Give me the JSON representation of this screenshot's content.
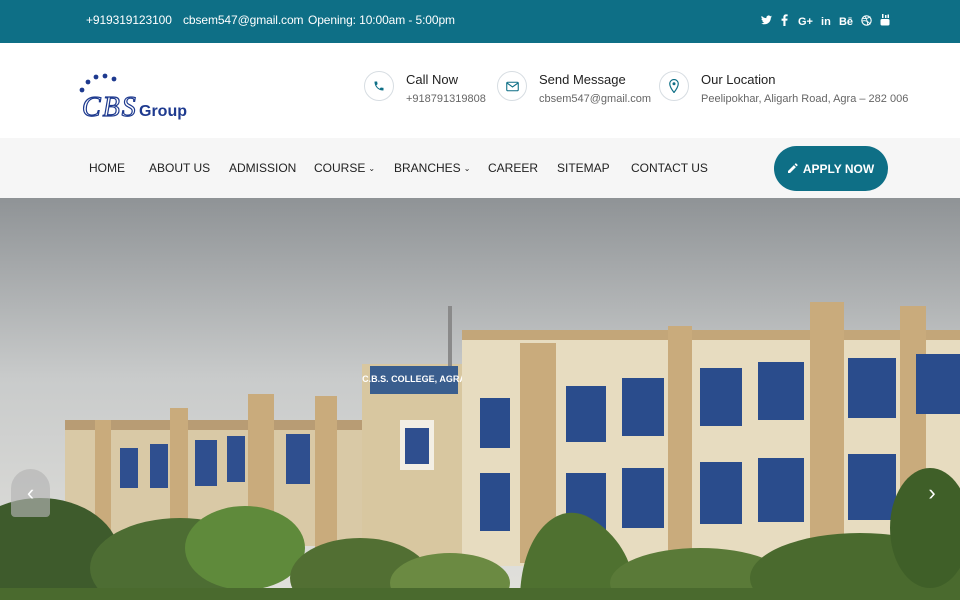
{
  "topbar": {
    "phone": "+919319123100",
    "email": "cbsem547@gmail.com",
    "hours": "Opening: 10:00am - 5:00pm",
    "social": [
      "twitter-icon",
      "facebook-icon",
      "google-plus-icon",
      "linkedin-icon",
      "behance-icon",
      "dribbble-icon",
      "youtube-icon"
    ],
    "social_glyphs": {
      "twitter": "🐦",
      "facebook": "f",
      "google": "G+",
      "linkedin": "in",
      "behance": "Bē",
      "dribbble": "◎",
      "youtube": "▶"
    }
  },
  "logo": {
    "text": "CBS Group"
  },
  "contacts": [
    {
      "title": "Call Now",
      "value": "+918791319808",
      "icon": "phone-icon"
    },
    {
      "title": "Send Message",
      "value": "cbsem547@gmail.com",
      "icon": "envelope-icon"
    },
    {
      "title": "Our Location",
      "value": "Peelipokhar, Aligarh Road, Agra – 282 006",
      "icon": "map-marker-icon"
    }
  ],
  "nav": {
    "items": [
      "HOME",
      "ABOUT US",
      "ADMISSION",
      "COURSE",
      "BRANCHES",
      "CAREER",
      "SITEMAP",
      "CONTACT US"
    ],
    "apply_label": "APPLY NOW"
  },
  "hero": {
    "sign_text": "C.B.S. COLLEGE, AGRA",
    "prev_label": "‹",
    "next_label": "›"
  },
  "colors": {
    "primary": "#0e6f86",
    "nav_bg": "#f6f6f6",
    "logo_blue": "#1e3a8f"
  }
}
